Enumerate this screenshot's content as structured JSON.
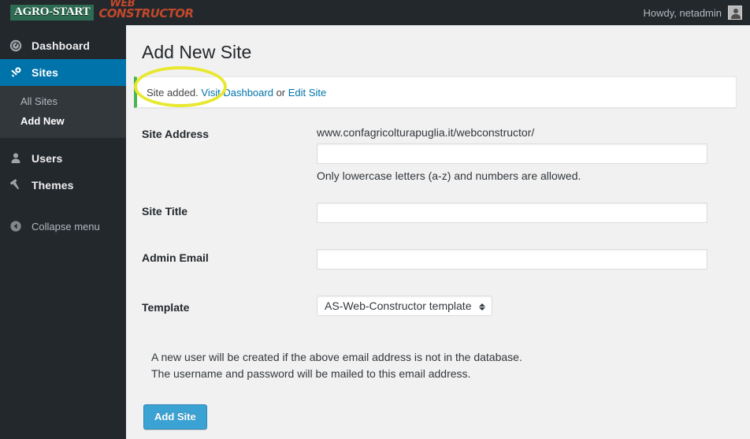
{
  "adminbar": {
    "brand": {
      "agro": "AGRO-START",
      "web": "Web",
      "constructor": "Constructor"
    },
    "howdy": "Howdy, netadmin",
    "avatar_icon": "user-avatar-icon"
  },
  "sidebar": {
    "items": [
      {
        "label": "Dashboard",
        "icon": "dashboard-gauge-icon",
        "current": false
      },
      {
        "label": "Sites",
        "icon": "key-icon",
        "current": true
      },
      {
        "label": "Users",
        "icon": "user-icon",
        "current": false
      },
      {
        "label": "Themes",
        "icon": "paintbrush-icon",
        "current": false
      }
    ],
    "submenu": [
      {
        "label": "All Sites",
        "current": false
      },
      {
        "label": "Add New",
        "current": true
      }
    ],
    "collapse": {
      "label": "Collapse menu",
      "icon": "collapse-left-arrow-icon"
    }
  },
  "page": {
    "title": "Add New Site"
  },
  "notice": {
    "text": "Site added.",
    "link_visit": "Visit Dashboard",
    "between": "or",
    "link_edit": "Edit Site",
    "accent_color": "#46b450"
  },
  "highlight": {
    "shape": "ellipse",
    "color": "#e8e830"
  },
  "form": {
    "site_address": {
      "label": "Site Address",
      "prefix": "www.confagricolturapuglia.it/webconstructor/",
      "value": "",
      "placeholder": "",
      "hint": "Only lowercase letters (a-z) and numbers are allowed."
    },
    "site_title": {
      "label": "Site Title",
      "value": "",
      "placeholder": ""
    },
    "admin_email": {
      "label": "Admin Email",
      "value": "",
      "placeholder": ""
    },
    "template": {
      "label": "Template",
      "selected": "AS-Web-Constructor template",
      "options": [
        "AS-Web-Constructor template"
      ]
    },
    "footnote_line1": "A new user will be created if the above email address is not in the database.",
    "footnote_line2": "The username and password will be mailed to this email address.",
    "submit_label": "Add Site",
    "submit_color": "#3ba2d4"
  }
}
